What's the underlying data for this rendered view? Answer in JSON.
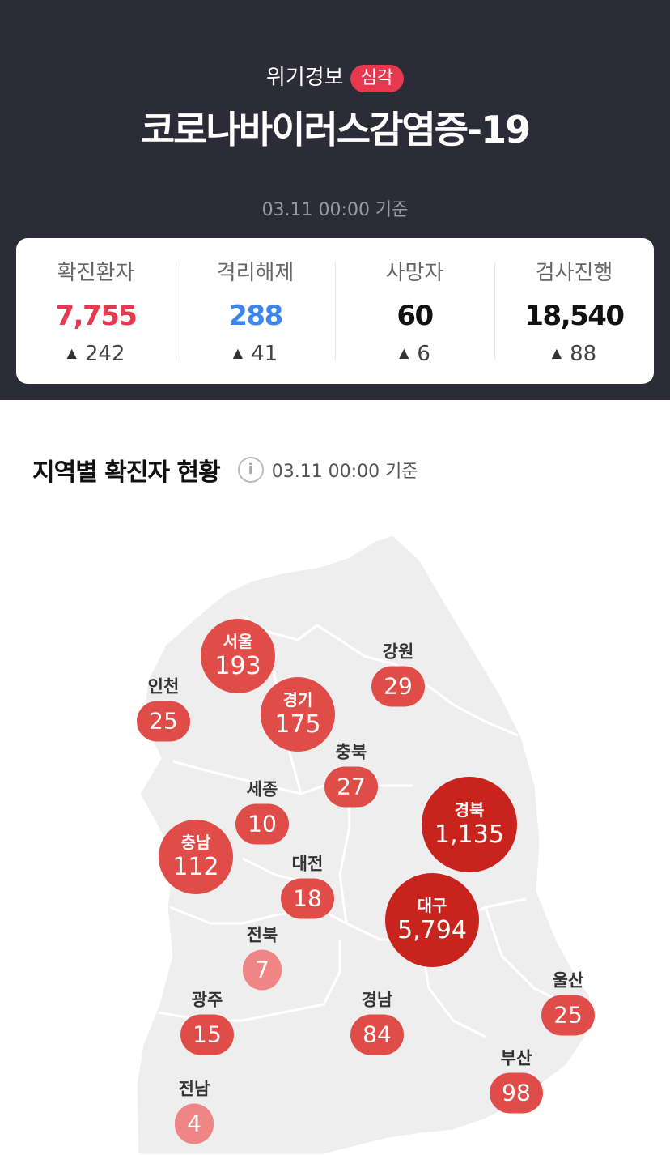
{
  "header": {
    "alert_label": "위기경보",
    "alert_level": "심각",
    "title": "코로나바이러스감염증-19",
    "basis": "03.11 00:00 기준"
  },
  "stats": [
    {
      "label": "확진환자",
      "value": "7,755",
      "delta": "242",
      "color": "#e8384f"
    },
    {
      "label": "격리해제",
      "value": "288",
      "delta": "41",
      "color": "#3d86f0"
    },
    {
      "label": "사망자",
      "value": "60",
      "delta": "6",
      "color": "#111111"
    },
    {
      "label": "검사진행",
      "value": "18,540",
      "delta": "88",
      "color": "#111111"
    }
  ],
  "section": {
    "title": "지역별 확진자 현황",
    "info_icon": "info-icon",
    "basis": "03.11 00:00 기준"
  },
  "regions": {
    "seoul": {
      "name": "서울",
      "count": "193"
    },
    "gyeonggi": {
      "name": "경기",
      "count": "175"
    },
    "incheon": {
      "name": "인천",
      "count": "25"
    },
    "gangwon": {
      "name": "강원",
      "count": "29"
    },
    "chungbuk": {
      "name": "충북",
      "count": "27"
    },
    "sejong": {
      "name": "세종",
      "count": "10"
    },
    "chungnam": {
      "name": "충남",
      "count": "112"
    },
    "daejeon": {
      "name": "대전",
      "count": "18"
    },
    "gyeongbuk": {
      "name": "경북",
      "count": "1,135"
    },
    "daegu": {
      "name": "대구",
      "count": "5,794"
    },
    "jeonbuk": {
      "name": "전북",
      "count": "7"
    },
    "ulsan": {
      "name": "울산",
      "count": "25"
    },
    "gwangju": {
      "name": "광주",
      "count": "15"
    },
    "gyeongnam": {
      "name": "경남",
      "count": "84"
    },
    "busan": {
      "name": "부산",
      "count": "98"
    },
    "jeonnam": {
      "name": "전남",
      "count": "4"
    }
  },
  "colors": {
    "header_bg": "#2c2c39",
    "alert_red": "#e8384f",
    "confirmed": "#e8384f",
    "released": "#3d86f0",
    "map_land": "#eeeeee",
    "marker_dark": "#c8241d",
    "marker_mid": "#e04c47",
    "marker_light": "#ef8585"
  }
}
